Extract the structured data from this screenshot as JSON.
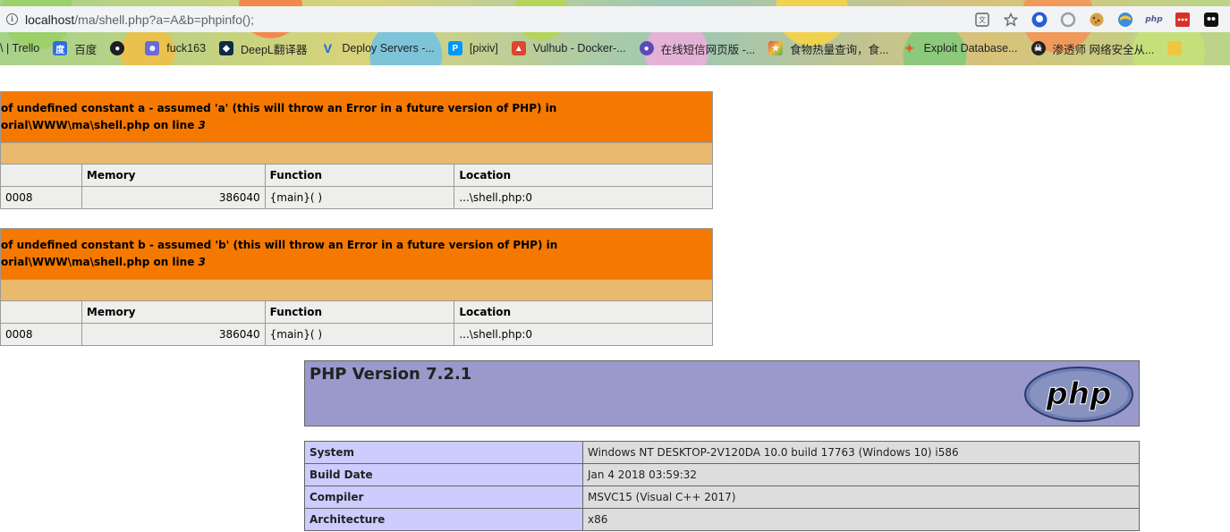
{
  "browser": {
    "url_host": "localhost",
    "url_path": "/ma/shell.php?a=A&b=phpinfo();",
    "bookmarks": [
      {
        "label": "\\ | Trello",
        "icon": "trello-icon"
      },
      {
        "label": "百度",
        "icon": "baidu-icon"
      },
      {
        "label": "",
        "icon": "github-icon"
      },
      {
        "label": "fuck163",
        "icon": "netease-icon"
      },
      {
        "label": "DeepL翻译器",
        "icon": "deepl-icon"
      },
      {
        "label": "Deploy Servers -...",
        "icon": "vultr-icon"
      },
      {
        "label": "[pixiv]",
        "icon": "pixiv-icon"
      },
      {
        "label": "Vulhub - Docker-...",
        "icon": "vulhub-icon"
      },
      {
        "label": "在线短信网页版 -...",
        "icon": "sms-icon"
      },
      {
        "label": "食物热量查询，食...",
        "icon": "food-icon"
      },
      {
        "label": "Exploit Database...",
        "icon": "exploitdb-icon"
      },
      {
        "label": "渗透师 网络安全从...",
        "icon": "pentest-icon"
      }
    ]
  },
  "notices": [
    {
      "message_line1": "of undefined constant a - assumed 'a' (this will throw an Error in a future version of PHP) in",
      "message_line2": "orial\\WWW\\ma\\shell.php on line",
      "line": "3",
      "headers": {
        "c1": "",
        "memory": "Memory",
        "function": "Function",
        "location": "Location"
      },
      "row": {
        "time": "0008",
        "memory": "386040",
        "function": "{main}( )",
        "location": "...\\shell.php:0"
      }
    },
    {
      "message_line1": "of undefined constant b - assumed 'b' (this will throw an Error in a future version of PHP) in",
      "message_line2": "orial\\WWW\\ma\\shell.php on line",
      "line": "3",
      "headers": {
        "c1": "",
        "memory": "Memory",
        "function": "Function",
        "location": "Location"
      },
      "row": {
        "time": "0008",
        "memory": "386040",
        "function": "{main}( )",
        "location": "...\\shell.php:0"
      }
    }
  ],
  "phpinfo": {
    "version_title": "PHP Version 7.2.1",
    "logo_text": "php",
    "rows": [
      {
        "key": "System",
        "value": "Windows NT DESKTOP-2V120DA 10.0 build 17763 (Windows 10) i586"
      },
      {
        "key": "Build Date",
        "value": "Jan 4 2018 03:59:32"
      },
      {
        "key": "Compiler",
        "value": "MSVC15 (Visual C++ 2017)"
      },
      {
        "key": "Architecture",
        "value": "x86"
      }
    ]
  },
  "colors": {
    "xdebug_message": "#f57900",
    "xdebug_callstack": "#e9b96e",
    "xdebug_row": "#eeeeec",
    "php_header": "#9999cc",
    "php_key": "#ccccff",
    "php_value": "#dddddd"
  }
}
